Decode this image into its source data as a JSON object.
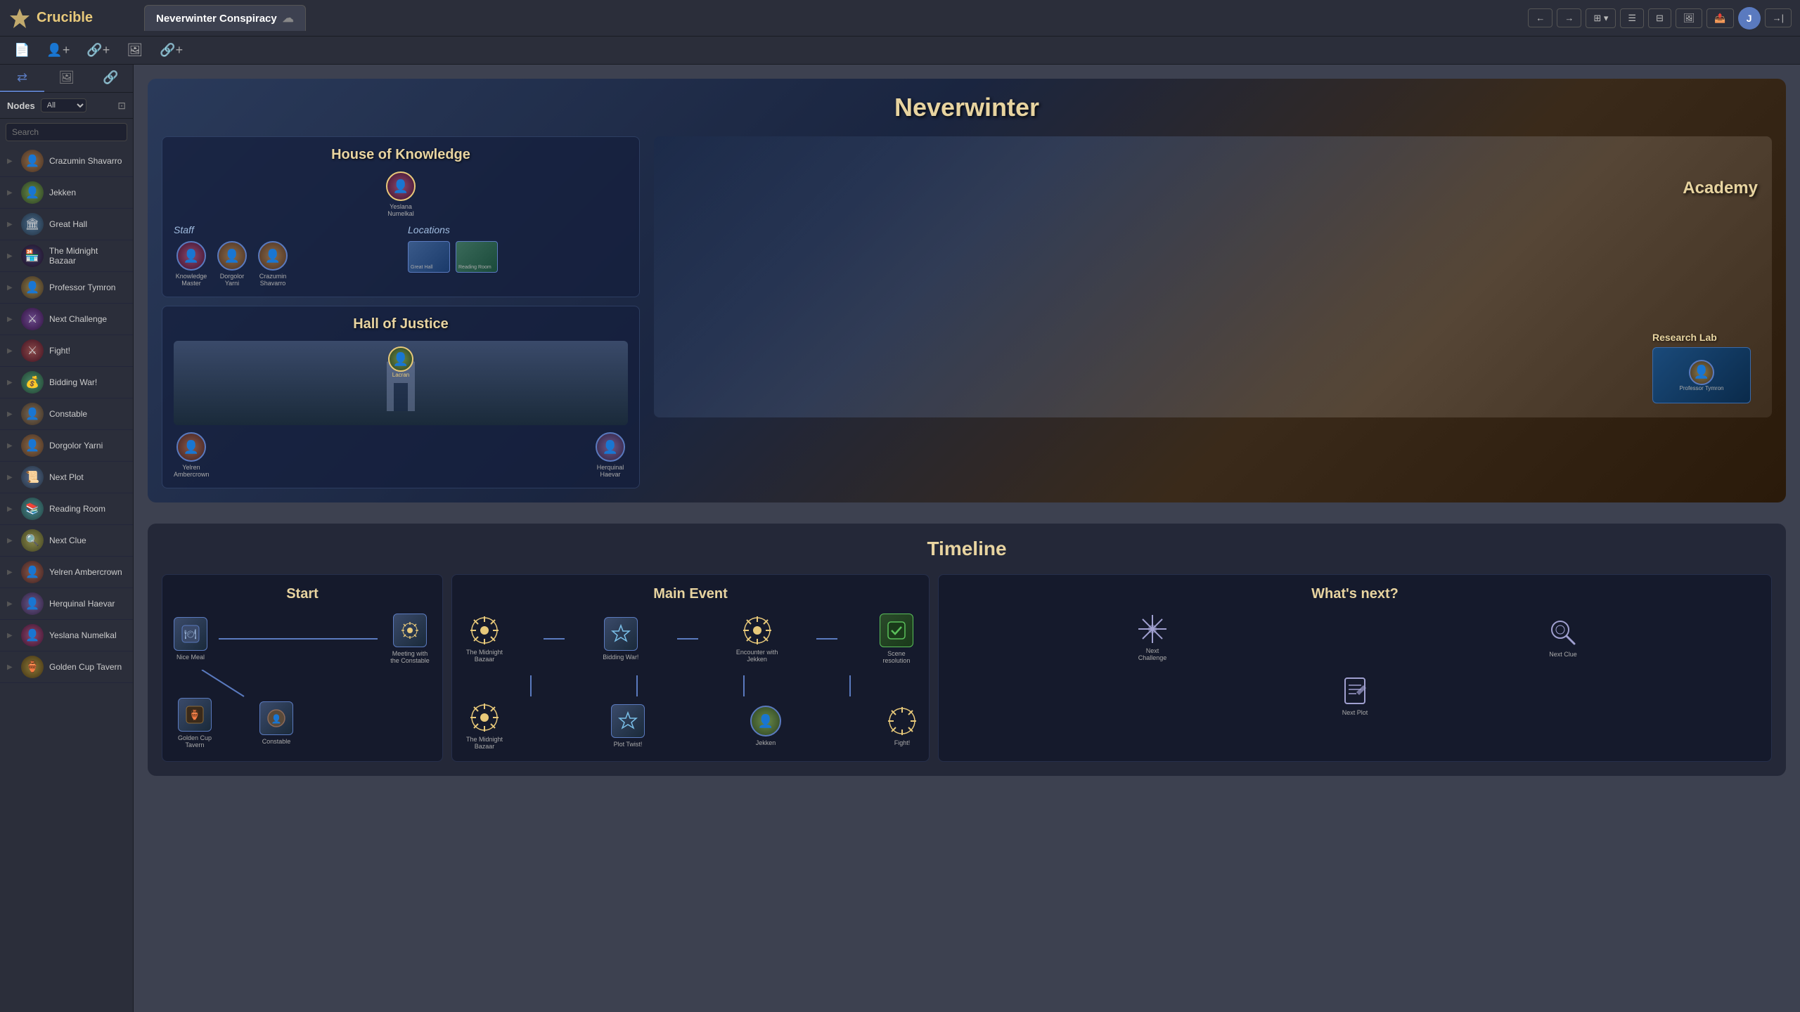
{
  "app": {
    "name": "Crucible",
    "logo": "🔥"
  },
  "topbar": {
    "project_title": "Neverwinter Conspiracy",
    "back_btn": "←",
    "forward_btn": "→",
    "avatar_label": "J",
    "exit_btn": "→|"
  },
  "subtoolbar": {
    "add_node_label": "+",
    "add_link_label": "+",
    "add_image_label": "+",
    "add_ref_label": "+"
  },
  "sidebar": {
    "nodes_label": "Nodes",
    "filter_default": "All",
    "search_placeholder": "Search",
    "items": [
      {
        "id": "crazumin",
        "label": "Crazumin Shavarro",
        "type": "person"
      },
      {
        "id": "jekken",
        "label": "Jekken",
        "type": "person"
      },
      {
        "id": "great-hall",
        "label": "Great Hall",
        "type": "place"
      },
      {
        "id": "midnight-bazaar",
        "label": "The Midnight Bazaar",
        "type": "place"
      },
      {
        "id": "professor",
        "label": "Professor Tymron",
        "type": "person"
      },
      {
        "id": "next-challenge",
        "label": "Next Challenge",
        "type": "event"
      },
      {
        "id": "fight",
        "label": "Fight!",
        "type": "event"
      },
      {
        "id": "bidding-war",
        "label": "Bidding War!",
        "type": "event"
      },
      {
        "id": "constable",
        "label": "Constable",
        "type": "person"
      },
      {
        "id": "dorgolor",
        "label": "Dorgolor Yarni",
        "type": "person"
      },
      {
        "id": "next-plot",
        "label": "Next Plot",
        "type": "event"
      },
      {
        "id": "reading-room",
        "label": "Reading Room",
        "type": "place"
      },
      {
        "id": "next-clue",
        "label": "Next Clue",
        "type": "event"
      },
      {
        "id": "yelren",
        "label": "Yelren Ambercrown",
        "type": "person"
      },
      {
        "id": "herquinal",
        "label": "Herquinal Haevar",
        "type": "person"
      },
      {
        "id": "yeslana",
        "label": "Yeslana Numelkal",
        "type": "person"
      },
      {
        "id": "golden-cup",
        "label": "Golden Cup Tavern",
        "type": "place"
      }
    ]
  },
  "map": {
    "city_name": "Neverwinter",
    "house_of_knowledge": {
      "title": "House of Knowledge",
      "staff_label": "Staff",
      "locations_label": "Locations",
      "staff_members": [
        {
          "name": "Knowledge Master",
          "id": "yeslana"
        },
        {
          "name": "Dorgolor Yarni",
          "id": "dorgolor"
        },
        {
          "name": "Crazumin Shavarro",
          "id": "crazumin"
        }
      ],
      "location_items": [
        {
          "name": "Great Hall",
          "id": "great-hall"
        },
        {
          "name": "Reading Room",
          "id": "reading-room"
        }
      ]
    },
    "academy": {
      "title": "Academy"
    },
    "research_lab": {
      "title": "Research Lab",
      "staff": [
        {
          "name": "Professor Tymron",
          "id": "professor"
        }
      ]
    },
    "hall_of_justice": {
      "title": "Hall of Justice",
      "persons": [
        {
          "name": "Lacran",
          "id": "jekken"
        },
        {
          "name": "Yelren Ambercrown",
          "id": "yelren"
        },
        {
          "name": "Herquinal Haevar",
          "id": "herquinal"
        }
      ]
    }
  },
  "timeline": {
    "title": "Timeline",
    "columns": {
      "start": {
        "label": "Start",
        "row1": [
          {
            "label": "Nice Meal",
            "type": "person"
          },
          {
            "label": "Meeting with the Constable",
            "type": "event"
          }
        ],
        "row2": [
          {
            "label": "Golden Cup Tavern",
            "type": "place"
          },
          {
            "label": "Constable",
            "type": "person"
          }
        ]
      },
      "main": {
        "label": "Main Event",
        "row1": [
          {
            "label": "The Midnight Bazaar",
            "type": "sun"
          },
          {
            "label": "Bidding War!",
            "type": "event"
          },
          {
            "label": "Encounter with Jekken",
            "type": "sun"
          },
          {
            "label": "Scene resolution",
            "type": "check"
          }
        ],
        "row2": [
          {
            "label": "The Midnight Bazaar",
            "type": "sun"
          },
          {
            "label": "Plot Twist!",
            "type": "event"
          },
          {
            "label": "Jekken",
            "type": "person"
          },
          {
            "label": "Fight!",
            "type": "sun"
          }
        ]
      },
      "next": {
        "label": "What's next?",
        "row1": [
          {
            "label": "Next Challenge",
            "type": "star"
          },
          {
            "label": "Next Clue",
            "type": "magnify"
          }
        ],
        "row2": [
          {
            "label": "Next Plot",
            "type": "quill"
          }
        ]
      }
    }
  }
}
